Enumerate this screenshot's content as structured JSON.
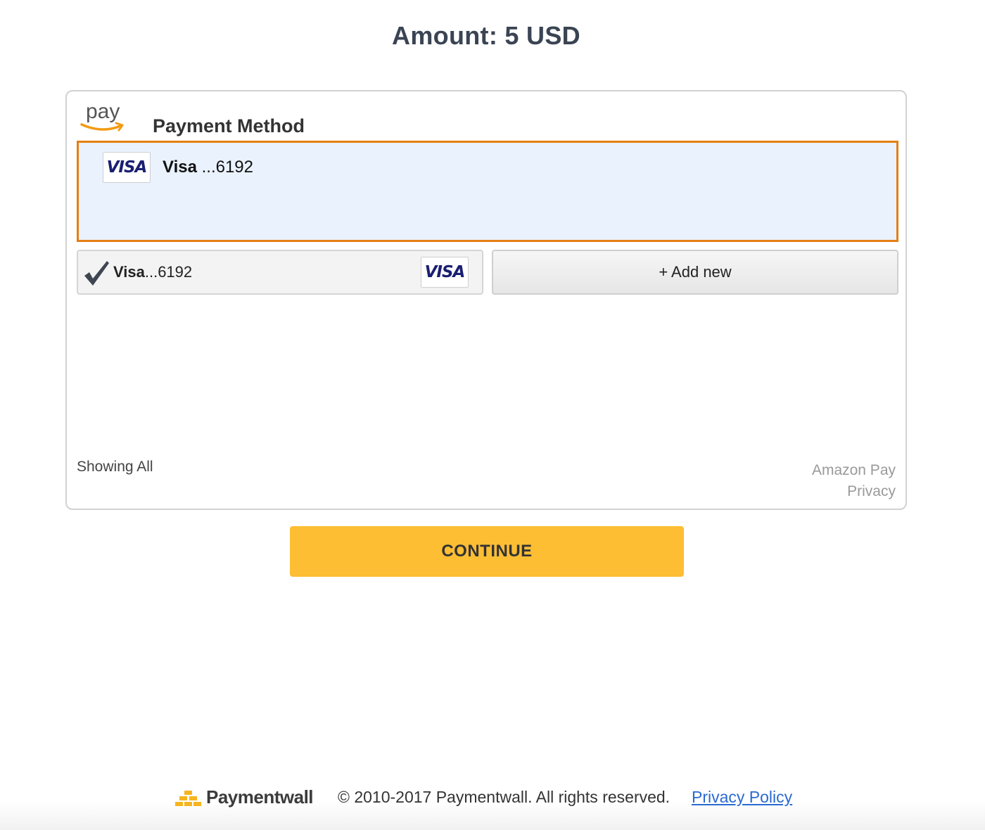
{
  "amount_title": "Amount: 5 USD",
  "widget": {
    "logo_text": "pay",
    "title": "Payment Method",
    "selected": {
      "brand": "Visa",
      "last_digits": " ...6192",
      "badge": "VISA"
    },
    "saved_card": {
      "brand": "Visa",
      "last_digits": "...6192",
      "badge": "VISA",
      "selected": true
    },
    "add_new_label": "+ Add new",
    "showing_all": "Showing All",
    "amazon_pay_label": "Amazon Pay",
    "privacy_label": "Privacy"
  },
  "continue_label": "CONTINUE",
  "footer": {
    "logo_text": "Paymentwall",
    "copyright": "© 2010-2017 Paymentwall. All rights reserved.",
    "privacy_policy": "Privacy Policy"
  },
  "colors": {
    "accent_orange": "#e67e13",
    "selected_bg": "#eaf2fe",
    "continue_yellow": "#fdbe34",
    "link_blue": "#2a6ad1"
  }
}
